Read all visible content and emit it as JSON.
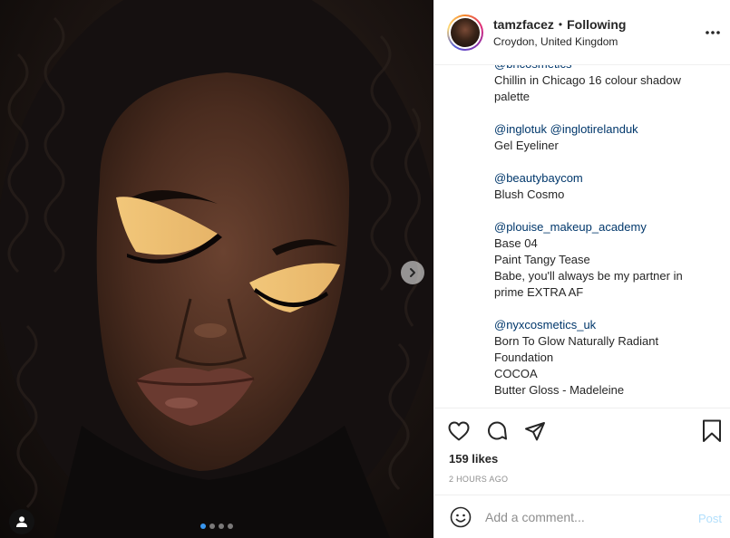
{
  "header": {
    "username": "tamzfacez",
    "separator": "•",
    "follow_status": "Following",
    "location": "Croydon, United Kingdom"
  },
  "caption": {
    "lines": [
      {
        "type": "mention",
        "text": "@bhcosmetics"
      },
      {
        "type": "text",
        "text": "Chillin in Chicago 16 colour shadow"
      },
      {
        "type": "text",
        "text": "palette"
      },
      {
        "type": "gap"
      },
      {
        "type": "mention",
        "text": "@inglotuk @inglotirelanduk"
      },
      {
        "type": "text",
        "text": "Gel Eyeliner"
      },
      {
        "type": "gap"
      },
      {
        "type": "mention",
        "text": "@beautybaycom"
      },
      {
        "type": "text",
        "text": "Blush Cosmo"
      },
      {
        "type": "gap"
      },
      {
        "type": "mention",
        "text": "@plouise_makeup_academy"
      },
      {
        "type": "text",
        "text": "Base 04"
      },
      {
        "type": "text",
        "text": "Paint Tangy Tease"
      },
      {
        "type": "text",
        "text": "Babe, you'll always be my partner in"
      },
      {
        "type": "text",
        "text": "prime EXTRA AF"
      },
      {
        "type": "gap"
      },
      {
        "type": "mention",
        "text": "@nyxcosmetics_uk"
      },
      {
        "type": "text",
        "text": "Born To Glow Naturally Radiant"
      },
      {
        "type": "text",
        "text": "Foundation"
      },
      {
        "type": "text",
        "text": "COCOA"
      },
      {
        "type": "text",
        "text": "Butter Gloss - Madeleine"
      }
    ]
  },
  "actions": {
    "likes": "159 likes",
    "timestamp": "2 HOURS AGO"
  },
  "comment": {
    "placeholder": "Add a comment...",
    "post_label": "Post"
  },
  "carousel": {
    "total": 4,
    "active_index": 0
  },
  "icons": {
    "like": "heart-icon",
    "comment": "comment-icon",
    "share": "share-icon",
    "save": "bookmark-icon",
    "more": "more-options-icon",
    "emoji": "emoji-icon",
    "next": "chevron-right-icon",
    "tag": "user-tag-icon"
  },
  "colors": {
    "link": "#00376b",
    "post_disabled": "#b2dffc",
    "muted": "#8e8e8e",
    "carousel_active": "#3897f0"
  }
}
